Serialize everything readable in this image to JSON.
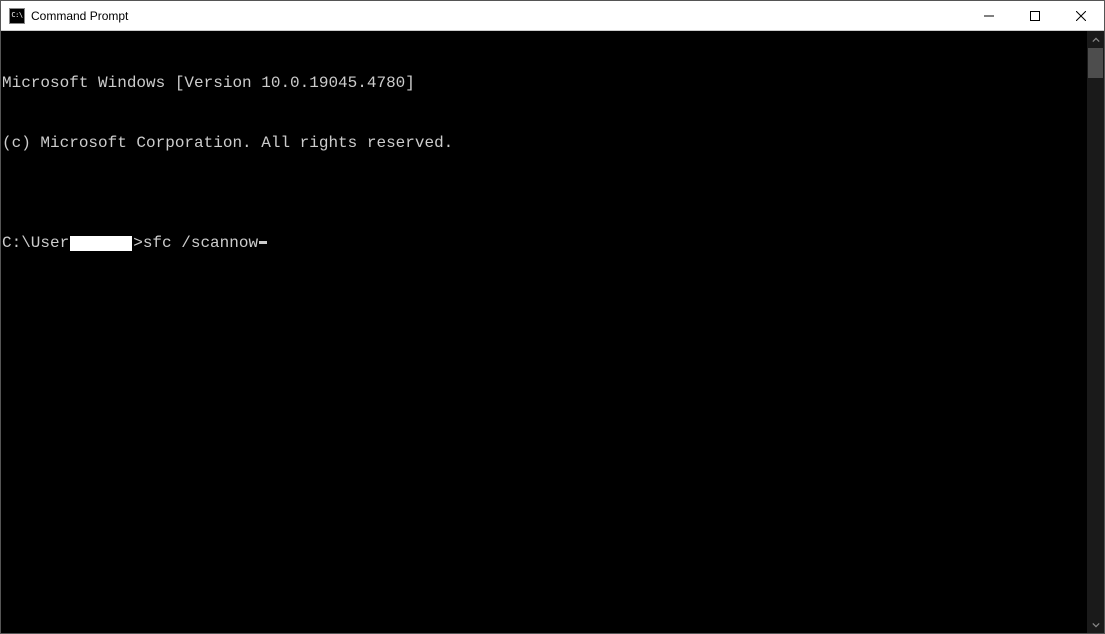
{
  "window": {
    "title": "Command Prompt",
    "icon_label": "C:\\"
  },
  "terminal": {
    "line1": "Microsoft Windows [Version 10.0.19045.4780]",
    "line2": "(c) Microsoft Corporation. All rights reserved.",
    "blank": "",
    "prompt_prefix": "C:\\User",
    "prompt_suffix": ">",
    "command": "sfc /scannow"
  }
}
